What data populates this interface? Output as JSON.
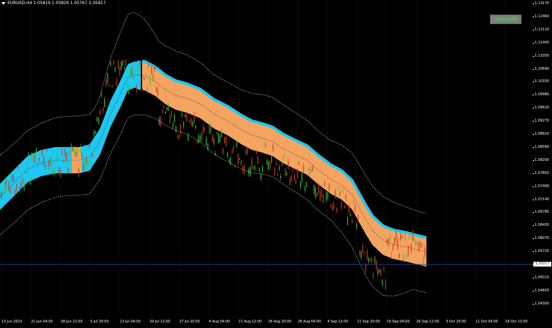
{
  "header": {
    "symbol_line": "EURUSD,H4  1.05819 1.05829 1.05767 1.05817"
  },
  "indicator_badge": "Vidya.mft",
  "current_price": "1.05817",
  "price_axis": [
    "1.13170",
    "1.12460",
    "1.12110",
    "1.11400",
    "1.11050",
    "1.10690",
    "1.10330",
    "1.09980",
    "1.09620",
    "1.09270",
    "1.08910",
    "1.08560",
    "1.08200",
    "1.07850",
    "1.07490",
    "1.07140",
    "1.06780",
    "1.06430",
    "1.06070",
    "1.05720",
    "1.05360",
    "1.05010",
    "1.04650",
    "1.04300"
  ],
  "time_axis": [
    "13 Jun 2023",
    "21 Jun 04:00",
    "28 Jun 12:00",
    "5 Jul 20:00",
    "13 Jul 04:00",
    "20 Jul 12:00",
    "27 Jul 20:00",
    "4 Aug 04:00",
    "11 Aug 12:00",
    "18 Aug 20:00",
    "28 Aug 04:00",
    "4 Sep 12:00",
    "11 Sep 20:00",
    "19 Sep 04:00",
    "26 Sep 12:00",
    "3 Oct 20:00",
    "11 Oct 04:00",
    "18 Oct 12:00"
  ],
  "colors": {
    "background": "#000000",
    "band_up": "#1ec8f0",
    "band_down": "#f4a460",
    "candle": "#3cc03c",
    "candle_down": "#c83c1e",
    "envelope": "#ffffff"
  }
}
